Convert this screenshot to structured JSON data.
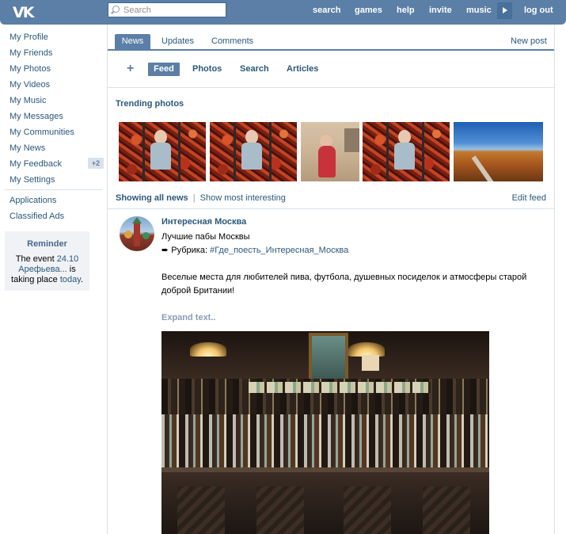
{
  "header": {
    "logo": "VK",
    "search_placeholder": "Search",
    "nav": [
      "search",
      "games",
      "help",
      "invite",
      "music",
      "log out"
    ]
  },
  "sidebar": {
    "items": [
      "My Profile",
      "My Friends",
      "My Photos",
      "My Videos",
      "My Music",
      "My Messages",
      "My Communities",
      "My News",
      "My Feedback",
      "My Settings"
    ],
    "feedback_badge": "+2",
    "extra_items": [
      "Applications",
      "Classified Ads"
    ],
    "reminder": {
      "title": "Reminder",
      "text_before": "The event",
      "date": "24.10",
      "event_name": "Арефьева...",
      "text_middle": "is taking place",
      "when": "today",
      "text_after": "."
    }
  },
  "tabs": {
    "news": "News",
    "updates": "Updates",
    "comments": "Comments",
    "new_post": "New post"
  },
  "subnav": {
    "plus": "+",
    "feed": "Feed",
    "photos": "Photos",
    "search": "Search",
    "articles": "Articles"
  },
  "trending": {
    "title": "Trending photos"
  },
  "filters": {
    "showing_all": "Showing all news",
    "separator": "|",
    "show_interesting": "Show most interesting",
    "edit_feed": "Edit feed"
  },
  "post": {
    "author": "Интересная Москва",
    "title": "Лучшие пабы Москвы",
    "rubric_prefix": "➨ Рубрика: ",
    "rubric_tag": "#Где_поесть_Интересная_Москва",
    "body": "Веселые места для любителей пива, футбола, душевных посиделок и атмосферы старой доброй Британии!",
    "expand": "Expand text.."
  },
  "colors": {
    "header_bg": "#5b7fa6",
    "link": "#2b587a",
    "active_tab": "#5b7fa6"
  }
}
